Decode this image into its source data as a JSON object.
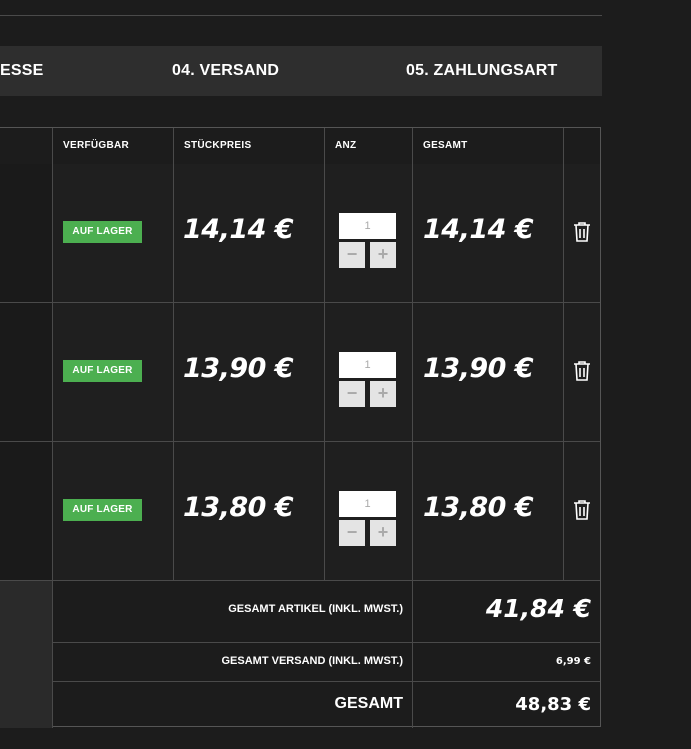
{
  "steps": {
    "address_partial": "ESSE",
    "shipping": "04. VERSAND",
    "payment": "05. ZAHLUNGSART"
  },
  "table": {
    "headers": {
      "available": "VERFÜGBAR",
      "unit_price": "STÜCKPREIS",
      "qty": "ANZ",
      "total": "GESAMT"
    },
    "rows": [
      {
        "availability": "AUF LAGER",
        "unit_price": "14,14 €",
        "qty": "1",
        "total": "14,14 €"
      },
      {
        "availability": "AUF LAGER",
        "unit_price": "13,90 €",
        "qty": "1",
        "total": "13,90 €"
      },
      {
        "availability": "AUF LAGER",
        "unit_price": "13,80 €",
        "qty": "1",
        "total": "13,80 €"
      }
    ],
    "qty_minus": "−",
    "qty_plus": "+"
  },
  "summary": {
    "items_label": "GESAMT ARTIKEL (INKL. MWST.)",
    "items_value": "41,84 €",
    "shipping_label": "GESAMT VERSAND (INKL. MWST.)",
    "shipping_value": "6,99 €",
    "total_label": "GESAMT",
    "total_value": "48,83 €"
  },
  "icons": {
    "delete": "trash-icon"
  },
  "colors": {
    "background": "#1c1c1c",
    "step_bar": "#2e2e2e",
    "in_stock_badge": "#4caf50",
    "text": "#ffffff"
  }
}
